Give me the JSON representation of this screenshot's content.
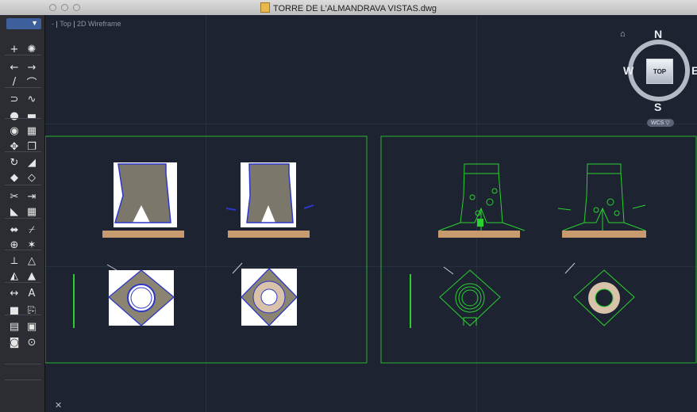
{
  "window": {
    "title": "TORRE DE L'ALMANDRAVA VISTAS.dwg"
  },
  "viewport_control": {
    "prefix": "-",
    "view": "Top",
    "style": "2D Wireframe"
  },
  "viewcube": {
    "north": "N",
    "south": "S",
    "east": "E",
    "west": "W",
    "face": "TOP",
    "wcs": "WCS ▽"
  },
  "toolbar": {
    "tools": [
      "selection-icon",
      "point-cloud-icon",
      "undo-icon",
      "redo-icon",
      "line-icon",
      "arc-icon",
      "polyline-icon",
      "spline-icon",
      "circle-icon",
      "rectangle-icon",
      "ellipse-icon",
      "hatch-icon",
      "move-icon",
      "copy-icon",
      "rotate-icon",
      "scale-icon",
      "mirror-icon",
      "offset-icon",
      "trim-icon",
      "extend-icon",
      "fillet-icon",
      "array-icon",
      "stretch-icon",
      "break-icon",
      "join-icon",
      "explode-icon",
      "measure-icon",
      "align-icon",
      "layer-icon",
      "match-properties-icon",
      "dimension-icon",
      "text-icon",
      "block-icon",
      "insert-icon",
      "table-icon",
      "field-icon",
      "isolate-icon",
      "zoom-icon"
    ]
  },
  "colors": {
    "drawing_green": "#29d12f",
    "stone_brown": "#c79b6e",
    "canvas": "#1d2331"
  }
}
